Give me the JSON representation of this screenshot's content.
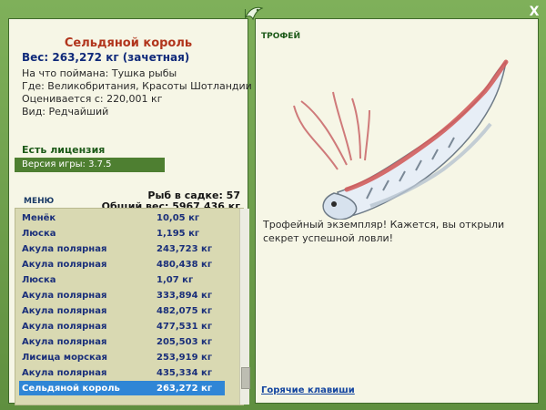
{
  "window": {
    "close_label": "X",
    "colors": {
      "frame_green": "#6a9a4a",
      "panel_bg": "#f6f6e6",
      "accent_red": "#b1351c",
      "accent_blue": "#102a7a",
      "selection_blue": "#2f86d6"
    }
  },
  "left": {
    "catch_title": "Сельдяной король",
    "catch_weight": "Вес: 263,272 кг (зачетная)",
    "info": {
      "bait": "На что поймана: Тушка рыбы",
      "location": "Где: Великобритания, Красоты Шотландии",
      "value": "Оценивается с: 220,001 кг",
      "kind": "Вид: Редчайший"
    },
    "license": "Есть лицензия",
    "version": "Версия игры: 3.7.5",
    "menu_tab": "МЕНЮ",
    "stats": {
      "fish_in_cage": "Рыб в садке: 57",
      "total_weight": "Общий вес: 5967,436 кг"
    },
    "list": [
      {
        "name": "Менёк",
        "weight": "10,05 кг"
      },
      {
        "name": "Люска",
        "weight": "1,195 кг"
      },
      {
        "name": "Акула полярная",
        "weight": "243,723 кг"
      },
      {
        "name": "Акула полярная",
        "weight": "480,438 кг"
      },
      {
        "name": "Люска",
        "weight": "1,07 кг"
      },
      {
        "name": "Акула полярная",
        "weight": "333,894 кг"
      },
      {
        "name": "Акула полярная",
        "weight": "482,075 кг"
      },
      {
        "name": "Акула полярная",
        "weight": "477,531 кг"
      },
      {
        "name": "Акула полярная",
        "weight": "205,503 кг"
      },
      {
        "name": "Лисица морская",
        "weight": "253,919 кг"
      },
      {
        "name": "Акула полярная",
        "weight": "435,334 кг"
      },
      {
        "name": "Сельдяной король",
        "weight": "263,272 кг",
        "selected": true
      }
    ]
  },
  "right": {
    "trophy_tab": "ТРОФЕЙ",
    "description": "Трофейный экземпляр! Кажется, вы открыли секрет успешной ловли!",
    "hotkeys": "Горячие клавиши",
    "fish_image": "oarfish-illustration"
  },
  "icons": {
    "top_leaf": "fish-leaf-icon",
    "close": "close-icon"
  }
}
